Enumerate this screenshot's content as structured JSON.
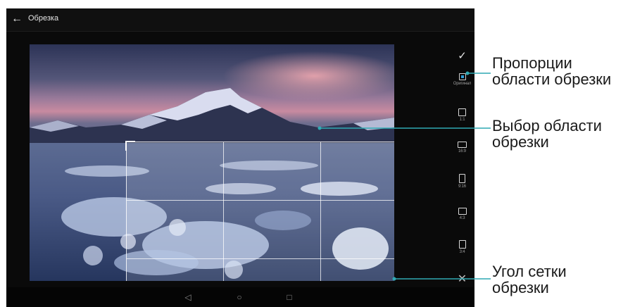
{
  "topbar": {
    "back_icon": "back-arrow-icon",
    "title": "Обрезка"
  },
  "sidebar": {
    "confirm_icon": "checkmark-icon",
    "ratios": [
      {
        "label": "Оригинал",
        "selected": true
      },
      {
        "label": "1:1",
        "selected": false
      },
      {
        "label": "16:9",
        "selected": false
      },
      {
        "label": "9:16",
        "selected": false
      },
      {
        "label": "4:3",
        "selected": false
      },
      {
        "label": "3:4",
        "selected": false
      }
    ],
    "cancel_icon": "close-icon"
  },
  "navbar": {
    "back_icon": "nav-back-triangle-icon",
    "home_icon": "nav-home-circle-icon",
    "recent_icon": "nav-recent-square-icon"
  },
  "callouts": {
    "aspect_ratio": "Пропорции\nобласти обрезки",
    "crop_selection": "Выбор области\nобрезки",
    "grid_corner": "Угол сетки\nобрезки"
  },
  "colors": {
    "callout_line": "#2fa9b3",
    "selected_ratio_accent": "#2e9fd8",
    "phone_background": "#0a0a0a"
  }
}
